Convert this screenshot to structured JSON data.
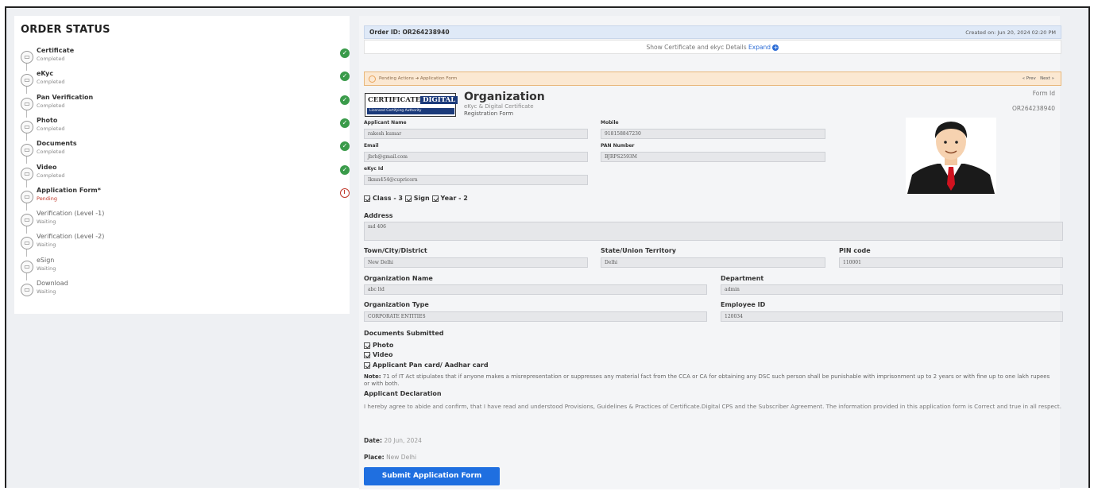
{
  "order_status": {
    "title": "ORDER STATUS",
    "steps": [
      {
        "name": "Certificate",
        "status": "Completed",
        "state": "done"
      },
      {
        "name": "eKyc",
        "status": "Completed",
        "state": "done"
      },
      {
        "name": "Pan Verification",
        "status": "Completed",
        "state": "done"
      },
      {
        "name": "Photo",
        "status": "Completed",
        "state": "done"
      },
      {
        "name": "Documents",
        "status": "Completed",
        "state": "done"
      },
      {
        "name": "Video",
        "status": "Completed",
        "state": "done"
      },
      {
        "name": "Application Form*",
        "status": "Pending",
        "state": "pending"
      },
      {
        "name": "Verification (Level -1)",
        "status": "Waiting",
        "state": "waiting"
      },
      {
        "name": "Verification (Level -2)",
        "status": "Waiting",
        "state": "waiting"
      },
      {
        "name": "eSign",
        "status": "Waiting",
        "state": "waiting"
      },
      {
        "name": "Download",
        "status": "Waiting",
        "state": "waiting"
      }
    ]
  },
  "header": {
    "order_id": "Order ID: OR264238940",
    "created_on": "Created on: Jun 20, 2024 02:20 PM",
    "show_details": "Show Certificate and ekyc Details",
    "expand": "Expand",
    "pending_actions": "Pending Actions ➜ Application Form",
    "prev": "« Prev",
    "next": "Next »"
  },
  "form_header": {
    "logo_line1": "CERTIFICATE",
    "logo_line1b": "DIGITAL",
    "logo_line2": "Licensed Certifying Authority",
    "title": "Organization",
    "subtitle": "eKyc & Digital Certificate",
    "subtitle2": "Registration Form",
    "form_id_label": "Form Id",
    "form_id": "OR264238940"
  },
  "fields": {
    "applicant_name_label": "Applicant Name",
    "applicant_name": "rakesh kumar",
    "mobile_label": "Mobile",
    "mobile": "918158847230",
    "email_label": "Email",
    "email": "jbrh@gmail.com",
    "pan_label": "PAN Number",
    "pan": "BJRPS2593M",
    "ekyc_label": "eKyc Id",
    "ekyc": "Ikmn454@cupricorn",
    "class_label": "Class - 3",
    "sign_label": "Sign",
    "year_label": "Year - 2",
    "address_label": "Address",
    "address": "md 406",
    "town_label": "Town/City/District",
    "town": "New Delhi",
    "state_label": "State/Union Territory",
    "state": "Delhi",
    "pin_label": "PIN code",
    "pin": "110001",
    "org_name_label": "Organization Name",
    "org_name": "abc ltd",
    "dept_label": "Department",
    "dept": "admin",
    "org_type_label": "Organization Type",
    "org_type": "CORPORATE ENTITIES",
    "emp_label": "Employee ID",
    "emp": "120034"
  },
  "documents": {
    "title": "Documents Submitted",
    "items": [
      "Photo",
      "Video",
      "Applicant Pan card/ Aadhar card"
    ]
  },
  "note": {
    "label": "Note:",
    "text": "71 of IT Act stipulates that if anyone makes a misrepresentation or suppresses any material fact from the CCA or CA for obtaining any DSC such person shall be punishable with imprisonment up to 2 years or with fine up to one lakh rupees or with both."
  },
  "declaration": {
    "title": "Applicant Declaration",
    "text": "I hereby agree to abide and confirm, that I have read and understood Provisions, Guidelines & Practices of Certificate.Digital CPS and the Subscriber Agreement. The information provided in this application form is Correct and true in all respect."
  },
  "footer": {
    "date_label": "Date:",
    "date": "20 Jun, 2024",
    "place_label": "Place:",
    "place": "New Delhi",
    "submit": "Submit Application Form"
  },
  "colors": {
    "accent": "#1f6fe0",
    "success": "#3a9b4a",
    "pending": "#c0392b"
  }
}
